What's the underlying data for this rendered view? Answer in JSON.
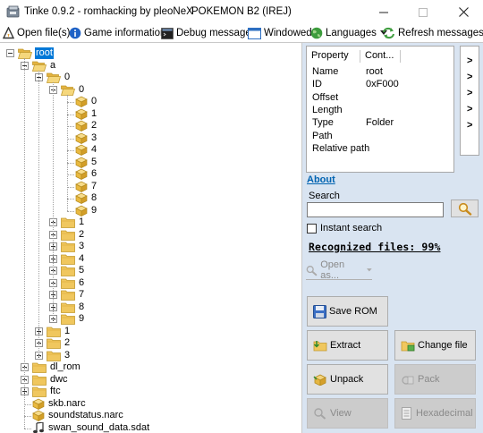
{
  "window": {
    "title": "Tinke 0.9.2 - romhacking by pleoNeX",
    "rom_name": "POKEMON B2 (IREJ)",
    "minimize_glyph": "—",
    "maximize_glyph": "☐",
    "close_glyph": "✕"
  },
  "toolbar": {
    "open_files": "Open file(s)",
    "game_information": "Game information",
    "debug_messages": "Debug messages",
    "windowed": "Windowed",
    "languages": "Languages",
    "refresh_messages": "Refresh messages"
  },
  "tree": {
    "root": "root",
    "a": "a",
    "a_0": "0",
    "a_0_0": "0",
    "files": [
      "0",
      "1",
      "2",
      "3",
      "4",
      "5",
      "6",
      "7",
      "8",
      "9"
    ],
    "subfolders": [
      "1",
      "2",
      "3",
      "4",
      "5",
      "6",
      "7",
      "8",
      "9"
    ],
    "a_subfolders": [
      "1",
      "2",
      "3"
    ],
    "root_folders": [
      "dl_rom",
      "dwc",
      "ftc"
    ],
    "root_files": [
      "skb.narc",
      "soundstatus.narc",
      "swan_sound_data.sdat"
    ]
  },
  "properties": {
    "header_property": "Property",
    "header_content": "Cont...",
    "rows": [
      {
        "name": "Name",
        "value": "root"
      },
      {
        "name": "ID",
        "value": "0xF000"
      },
      {
        "name": "Offset",
        "value": ""
      },
      {
        "name": "Length",
        "value": ""
      },
      {
        "name": "Type",
        "value": "Folder"
      },
      {
        "name": "Path",
        "value": ""
      },
      {
        "name": "Relative path",
        "value": ""
      }
    ]
  },
  "side_arrows": [
    ">",
    ">",
    ">",
    ">",
    ">"
  ],
  "about_label": "About",
  "search": {
    "label": "Search",
    "value": "",
    "instant_label": "Instant search"
  },
  "recognized_text": "Recognized files: 99%",
  "open_as_label": "Open as...",
  "buttons": {
    "save_rom": "Save ROM",
    "extract": "Extract",
    "change_file": "Change file",
    "unpack": "Unpack",
    "pack": "Pack",
    "view": "View",
    "hexadecimal": "Hexadecimal"
  },
  "colors": {
    "panel_bg": "#d9e4f1",
    "selection": "#0078d7",
    "folder": "#f0c75e",
    "file_box": "#e8b94a",
    "link": "#0063b1"
  }
}
